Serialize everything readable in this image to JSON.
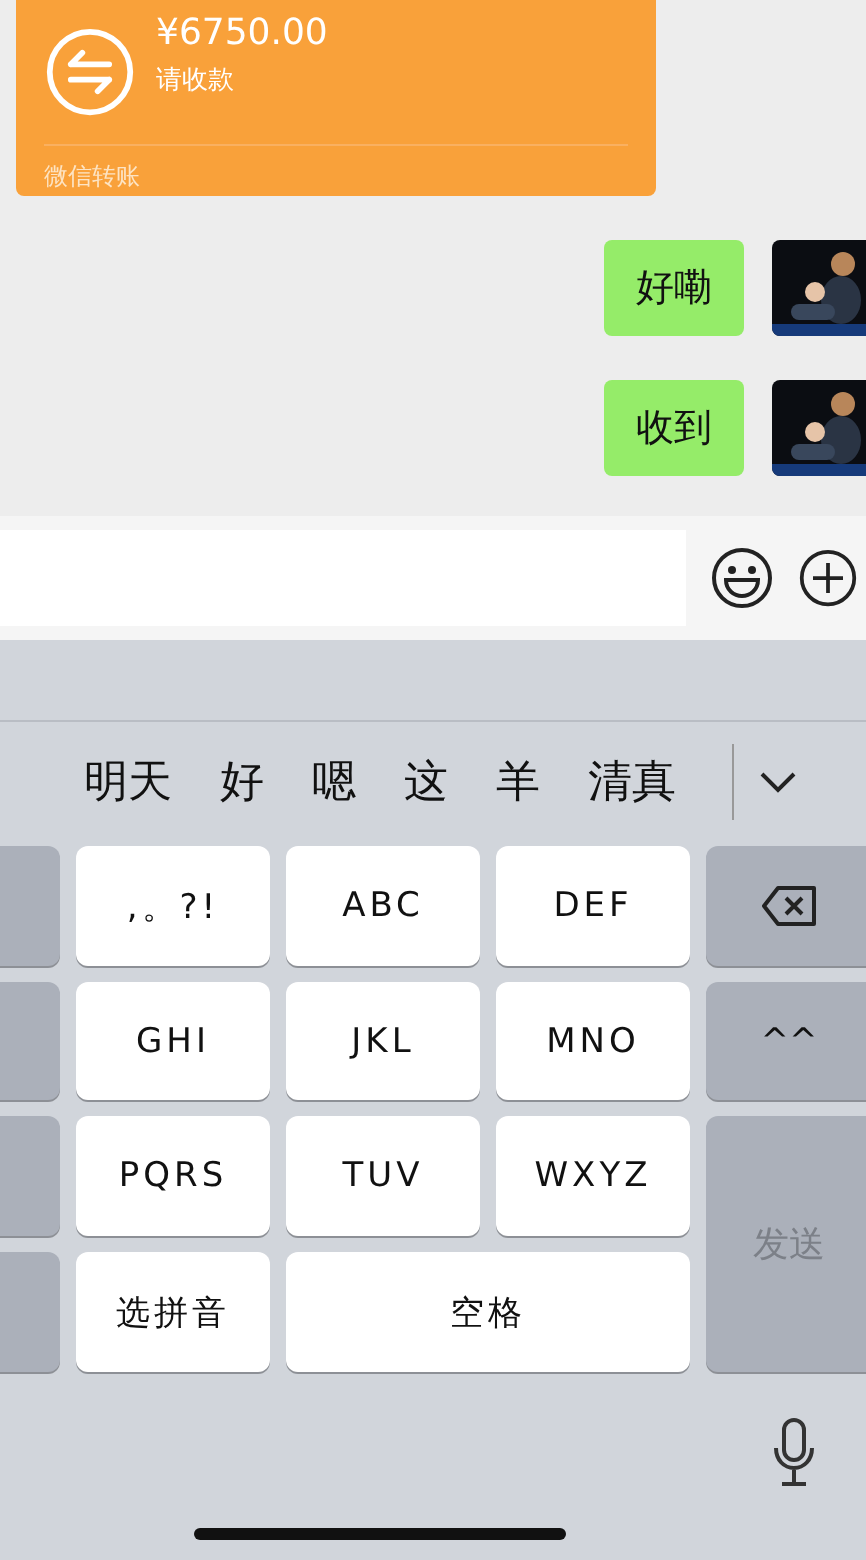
{
  "transfer": {
    "amount": "¥6750.00",
    "note": "请收款",
    "footer": "微信转账"
  },
  "messages": [
    {
      "text": "好嘞"
    },
    {
      "text": "收到"
    }
  ],
  "candidates": [
    "明天",
    "好",
    "嗯",
    "这",
    "羊",
    "清真"
  ],
  "keys": [
    {
      "label": ",。?!",
      "kind": "char"
    },
    {
      "label": "ABC",
      "kind": "char"
    },
    {
      "label": "DEF",
      "kind": "char"
    },
    {
      "label": "GHI",
      "kind": "char"
    },
    {
      "label": "JKL",
      "kind": "char"
    },
    {
      "label": "MNO",
      "kind": "char"
    },
    {
      "label": "PQRS",
      "kind": "char"
    },
    {
      "label": "TUV",
      "kind": "char"
    },
    {
      "label": "WXYZ",
      "kind": "char"
    },
    {
      "label": "选拼音",
      "kind": "char"
    },
    {
      "label": "空格",
      "kind": "space"
    }
  ],
  "emoticon_key": "^^",
  "send_key": {
    "label": "发送",
    "disabled": true
  }
}
